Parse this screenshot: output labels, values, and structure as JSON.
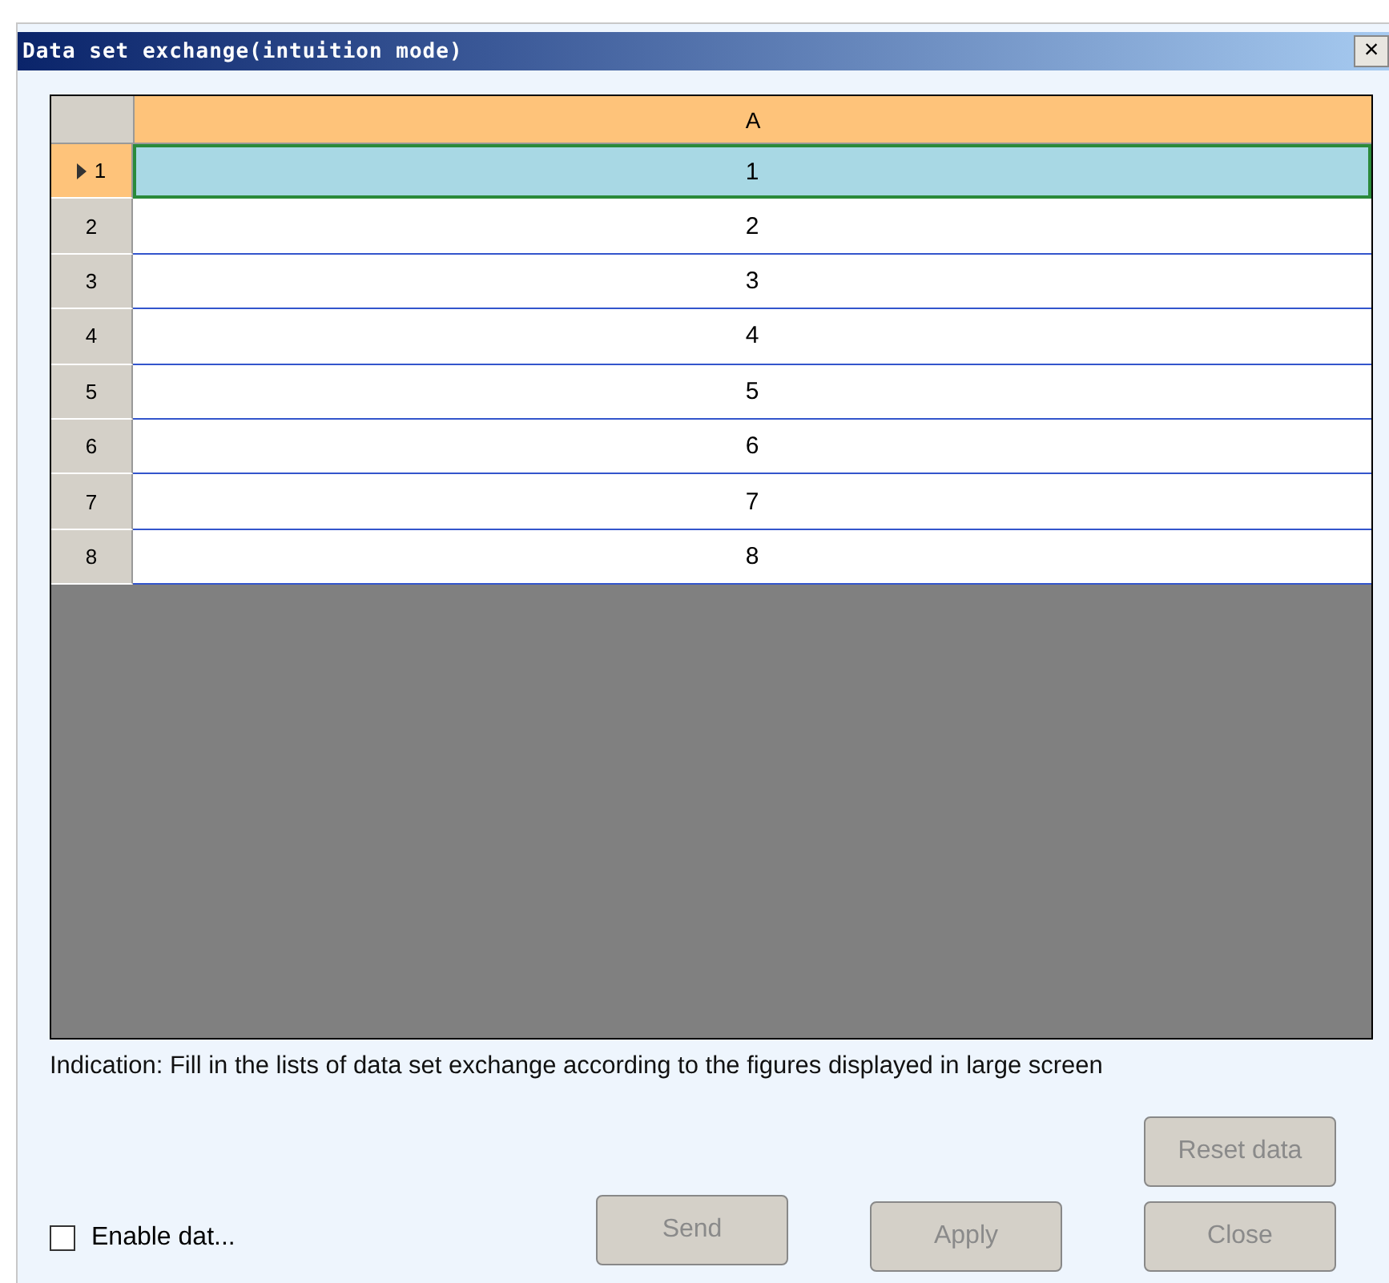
{
  "window": {
    "title": "Data set exchange(intuition mode)",
    "close_glyph": "×"
  },
  "grid": {
    "columns": [
      "A"
    ],
    "rows": [
      {
        "header": "1",
        "value": "1",
        "selected": true
      },
      {
        "header": "2",
        "value": "2",
        "selected": false
      },
      {
        "header": "3",
        "value": "3",
        "selected": false
      },
      {
        "header": "4",
        "value": "4",
        "selected": false
      },
      {
        "header": "5",
        "value": "5",
        "selected": false
      },
      {
        "header": "6",
        "value": "6",
        "selected": false
      },
      {
        "header": "7",
        "value": "7",
        "selected": false
      },
      {
        "header": "8",
        "value": "8",
        "selected": false
      }
    ]
  },
  "indication": "Indication: Fill in the lists of data set exchange according to the figures displayed in large screen",
  "enable_checkbox": {
    "label": "Enable dat...",
    "checked": false
  },
  "buttons": {
    "reset": {
      "label": "Reset data",
      "disabled": true
    },
    "send": {
      "label": "Send",
      "disabled": true
    },
    "apply": {
      "label": "Apply",
      "disabled": true
    },
    "close": {
      "label": "Close",
      "disabled": true
    }
  }
}
